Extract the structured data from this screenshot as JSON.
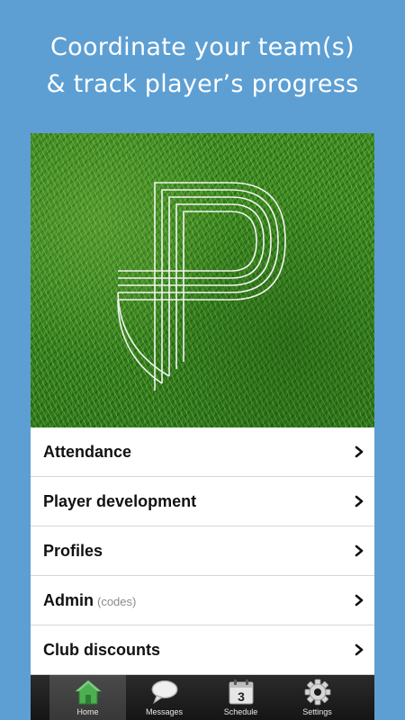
{
  "headline": {
    "line1": "Coordinate your team(s)",
    "line2": "& track player’s progress"
  },
  "menu": {
    "items": [
      {
        "label": "Attendance",
        "hint": ""
      },
      {
        "label": "Player development",
        "hint": ""
      },
      {
        "label": "Profiles",
        "hint": ""
      },
      {
        "label": "Admin",
        "hint": "(codes)"
      },
      {
        "label": "Club discounts",
        "hint": ""
      }
    ]
  },
  "tabbar": {
    "tabs": [
      {
        "label": "Home",
        "icon": "home-icon",
        "active": true
      },
      {
        "label": "Messages",
        "icon": "speech-bubble-icon",
        "active": false
      },
      {
        "label": "Schedule",
        "icon": "calendar-icon",
        "active": false,
        "badge": "3"
      },
      {
        "label": "Settings",
        "icon": "gear-icon",
        "active": false
      }
    ]
  },
  "colors": {
    "background": "#5d9fd3",
    "grass": "#3a8a22",
    "tabbar": "#1c1c1c",
    "home_icon": "#4caf50"
  }
}
